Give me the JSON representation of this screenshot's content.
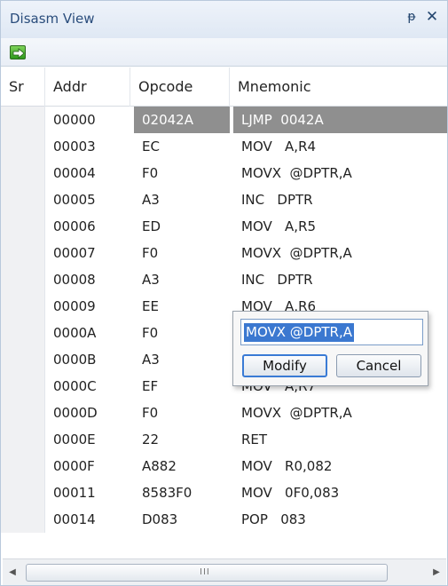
{
  "window": {
    "title": "Disasm View",
    "pin_glyph": "ᵽ",
    "close_glyph": "✕"
  },
  "toolbar": {
    "goto_icon": "goto-arrow-icon"
  },
  "columns": [
    "Sr",
    "Addr",
    "Opcode",
    "Mnemonic"
  ],
  "rows": [
    {
      "addr": "00000",
      "opcode": "02042A",
      "mnemonic": "LJMP  0042A",
      "selected": true
    },
    {
      "addr": "00003",
      "opcode": "EC",
      "mnemonic": "MOV   A,R4"
    },
    {
      "addr": "00004",
      "opcode": "F0",
      "mnemonic": "MOVX  @DPTR,A"
    },
    {
      "addr": "00005",
      "opcode": "A3",
      "mnemonic": "INC   DPTR"
    },
    {
      "addr": "00006",
      "opcode": "ED",
      "mnemonic": "MOV   A,R5"
    },
    {
      "addr": "00007",
      "opcode": "F0",
      "mnemonic": "MOVX  @DPTR,A"
    },
    {
      "addr": "00008",
      "opcode": "A3",
      "mnemonic": "INC   DPTR"
    },
    {
      "addr": "00009",
      "opcode": "EE",
      "mnemonic": "MOV   A,R6"
    },
    {
      "addr": "0000A",
      "opcode": "F0",
      "mnemonic": ""
    },
    {
      "addr": "0000B",
      "opcode": "A3",
      "mnemonic": ""
    },
    {
      "addr": "0000C",
      "opcode": "EF",
      "mnemonic": "MOV   A,R7"
    },
    {
      "addr": "0000D",
      "opcode": "F0",
      "mnemonic": "MOVX  @DPTR,A"
    },
    {
      "addr": "0000E",
      "opcode": "22",
      "mnemonic": "RET"
    },
    {
      "addr": "0000F",
      "opcode": "A882",
      "mnemonic": "MOV   R0,082"
    },
    {
      "addr": "00011",
      "opcode": "8583F0",
      "mnemonic": "MOV   0F0,083"
    },
    {
      "addr": "00014",
      "opcode": "D083",
      "mnemonic": "POP   083"
    }
  ],
  "popup": {
    "input_value": "MOVX @DPTR,A",
    "modify_label": "Modify",
    "cancel_label": "Cancel"
  },
  "scrollbar": {
    "grip": "III",
    "left_arrow": "◀",
    "right_arrow": "▶"
  },
  "colors": {
    "selected_row": "#8f8f8f",
    "title_text": "#2a4d7c",
    "input_selection": "#3b78d0"
  }
}
